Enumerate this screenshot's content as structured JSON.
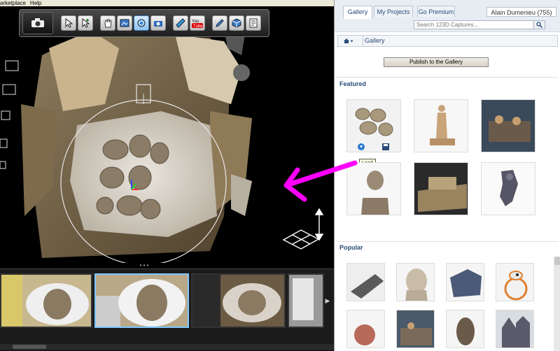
{
  "menubar": {
    "items": [
      "arketplace",
      "Help"
    ]
  },
  "toolbar": {
    "camera_icon": "camera-icon",
    "tools": [
      {
        "name": "select-tool",
        "icon": "select-arrow-icon"
      },
      {
        "name": "add-select-tool",
        "icon": "select-plus-icon"
      },
      {
        "name": "pan-tool",
        "icon": "hand-icon"
      },
      {
        "name": "frame-tool",
        "icon": "frame-icon"
      },
      {
        "name": "orbit-tool",
        "icon": "orbit-icon"
      },
      {
        "name": "camera-tool",
        "icon": "camera-small-icon"
      },
      {
        "name": "measure-tool",
        "icon": "ruler-icon"
      },
      {
        "name": "youtube-export",
        "icon": "youtube-icon"
      },
      {
        "name": "pen-tool",
        "icon": "pen-icon"
      },
      {
        "name": "mesh-tool",
        "icon": "mesh-cube-icon"
      },
      {
        "name": "notes-tool",
        "icon": "notes-icon"
      }
    ],
    "youtube_label": "You Tube",
    "active_tool": "orbit-tool"
  },
  "panel": {
    "tabs": [
      {
        "label": "Gallery",
        "active": true
      },
      {
        "label": "My Projects",
        "active": false
      },
      {
        "label": "Go Premium",
        "active": false
      }
    ],
    "user": "Alain Dumenieu (755)",
    "search": {
      "placeholder": "Search 123D Captures..."
    },
    "breadcrumb": {
      "home_icon": "home-icon",
      "current": "Gallery"
    },
    "publish_label": "Publish to the Gallery",
    "featured_title": "Featured",
    "popular_title": "Popular",
    "load_tooltip": "Load"
  },
  "colors": {
    "accent_blue": "#2a4d7a",
    "arrow_magenta": "#ff00ff",
    "selection_border": "#7ec8ff"
  }
}
